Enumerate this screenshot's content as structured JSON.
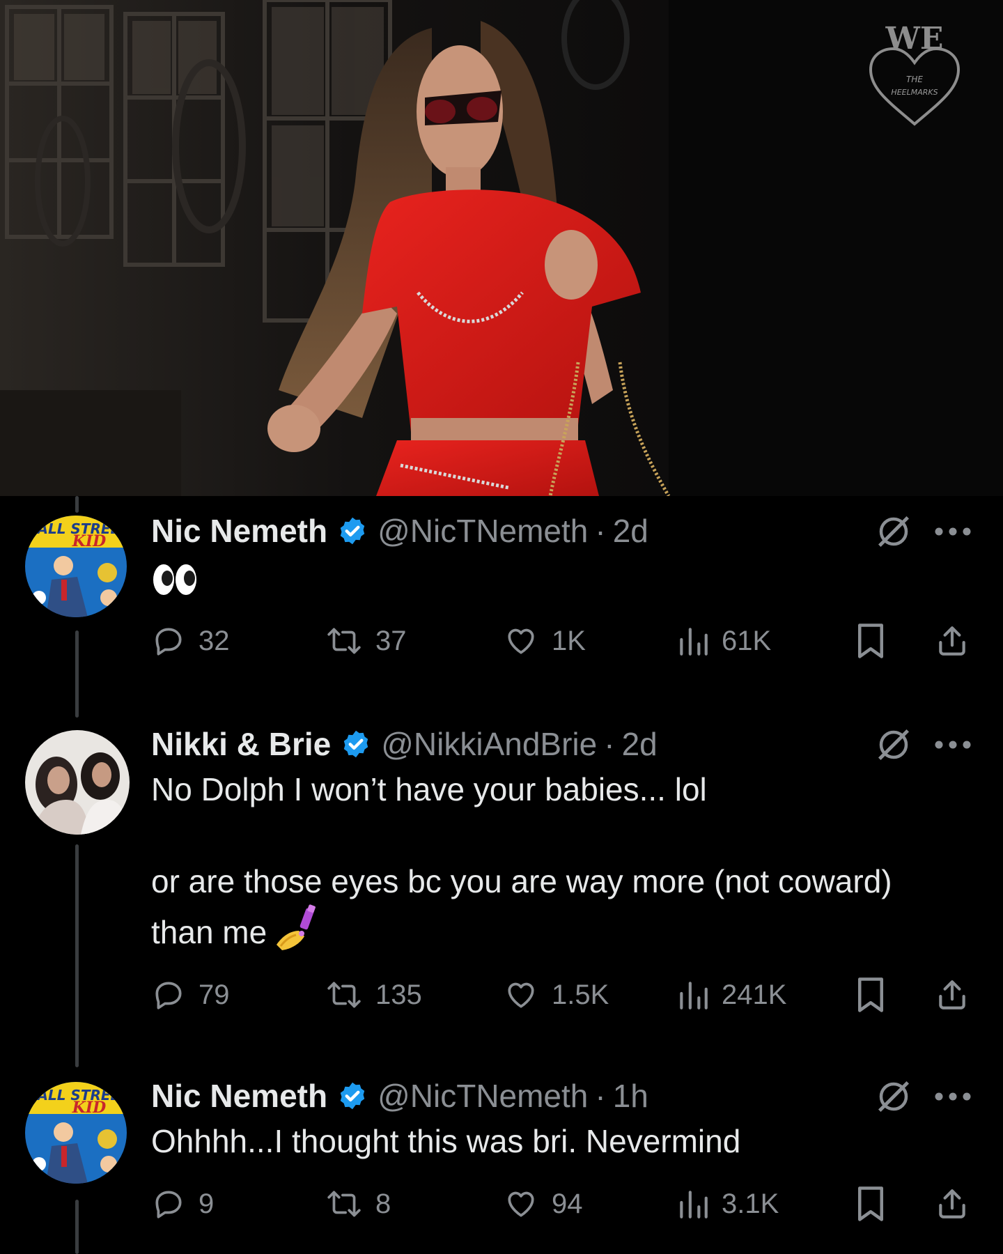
{
  "watermark": {
    "line1": "WE",
    "line2": "THE",
    "line3": "HEELMARKS"
  },
  "tweets": [
    {
      "name": "Nic Nemeth",
      "handle": "@NicTNemeth",
      "time": "2d",
      "text": "",
      "emoji": "eyes-emoji",
      "stats": {
        "replies": "32",
        "reposts": "37",
        "likes": "1K",
        "views": "61K"
      }
    },
    {
      "name": "Nikki & Brie",
      "handle": "@NikkiAndBrie",
      "time": "2d",
      "text": "No Dolph I won’t have your babies... lol\n\nor are those eyes bc you are way more (not coward) than me",
      "emoji": "nail-polish-emoji",
      "stats": {
        "replies": "79",
        "reposts": "135",
        "likes": "1.5K",
        "views": "241K"
      }
    },
    {
      "name": "Nic Nemeth",
      "handle": "@NicTNemeth",
      "time": "1h",
      "text": "Ohhhh...I thought this was bri. Nevermind",
      "emoji": "",
      "stats": {
        "replies": "9",
        "reposts": "8",
        "likes": "94",
        "views": "3.1K"
      }
    }
  ],
  "separator": "·",
  "avatar_labels": {
    "line1": "WALL STREET",
    "line2": "KID"
  },
  "colors": {
    "background": "#000000",
    "text": "#e7e9ea",
    "muted": "#8b8f94",
    "verified": "#1d9bf0",
    "thread_line": "#3a3d40"
  }
}
